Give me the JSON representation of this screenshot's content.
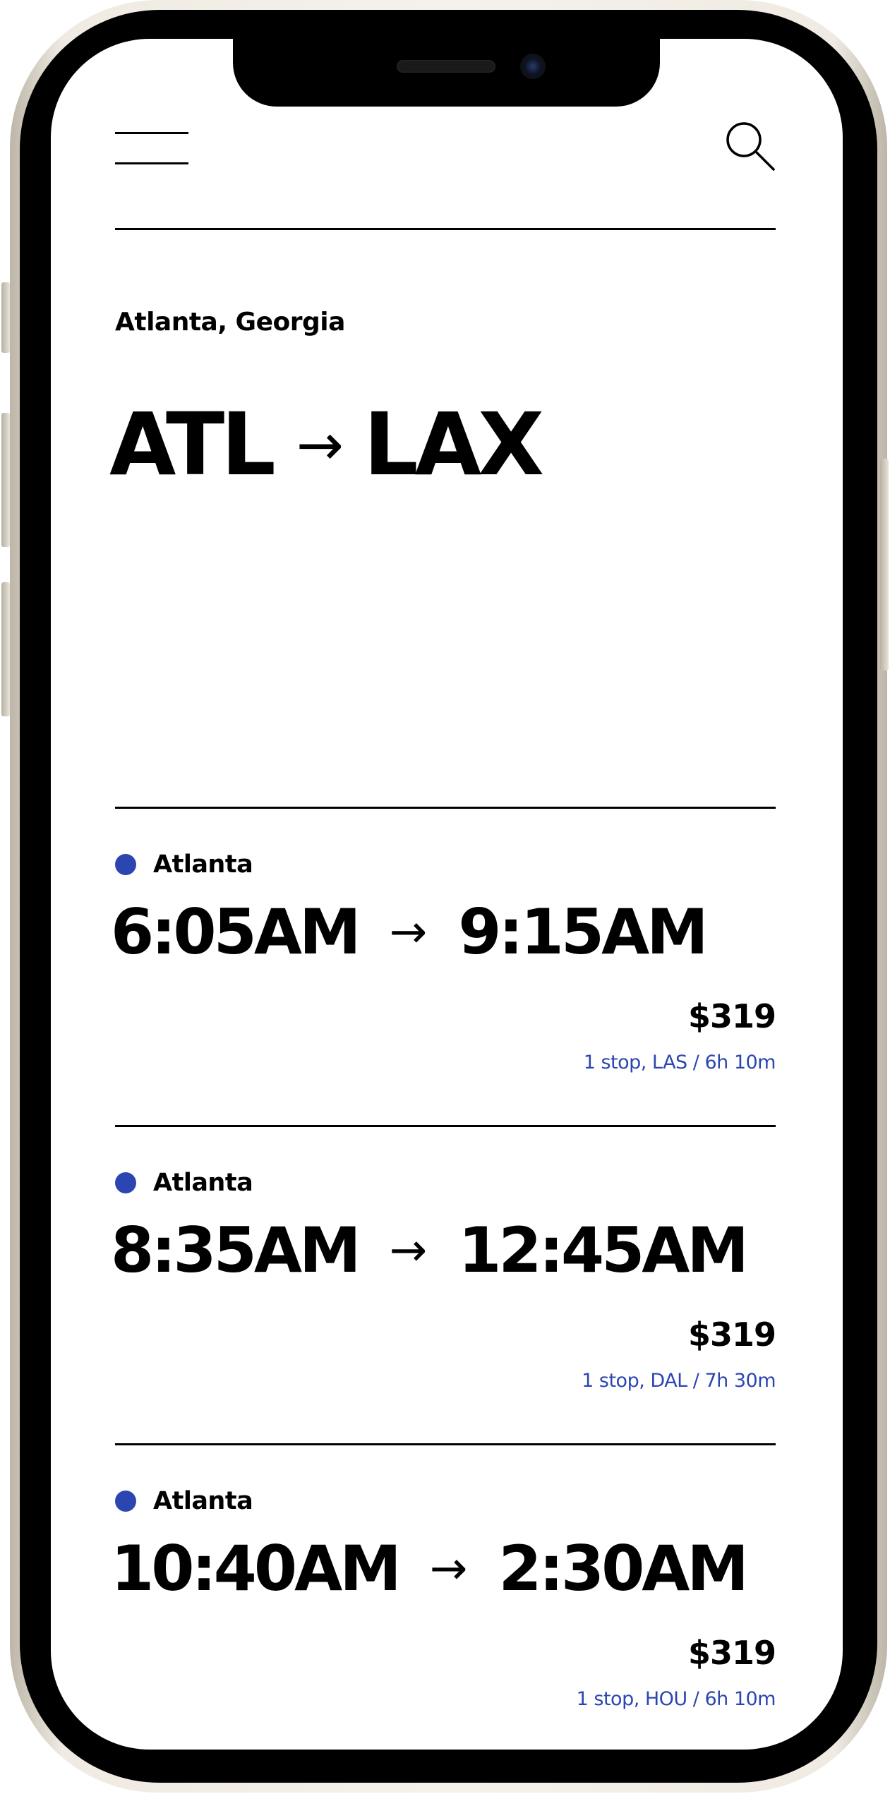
{
  "header": {
    "menu_icon": "hamburger-menu-icon",
    "search_icon": "search-icon"
  },
  "trip": {
    "city": "Atlanta, Georgia",
    "from_code": "ATL",
    "arrow": "→",
    "to_code": "LAX"
  },
  "flights": [
    {
      "origin": "Atlanta",
      "depart": "6:05AM",
      "arrow": "→",
      "arrive": "9:15AM",
      "price": "$319",
      "details": "1 stop, LAS / 6h 10m"
    },
    {
      "origin": "Atlanta",
      "depart": "8:35AM",
      "arrow": "→",
      "arrive": "12:45AM",
      "price": "$319",
      "details": "1 stop, DAL / 7h 30m"
    },
    {
      "origin": "Atlanta",
      "depart": "10:40AM",
      "arrow": "→",
      "arrive": "2:30AM",
      "price": "$319",
      "details": "1 stop, HOU / 6h 10m"
    }
  ],
  "colors": {
    "accent": "#2c46b1",
    "text": "#000000",
    "background": "#ffffff"
  }
}
